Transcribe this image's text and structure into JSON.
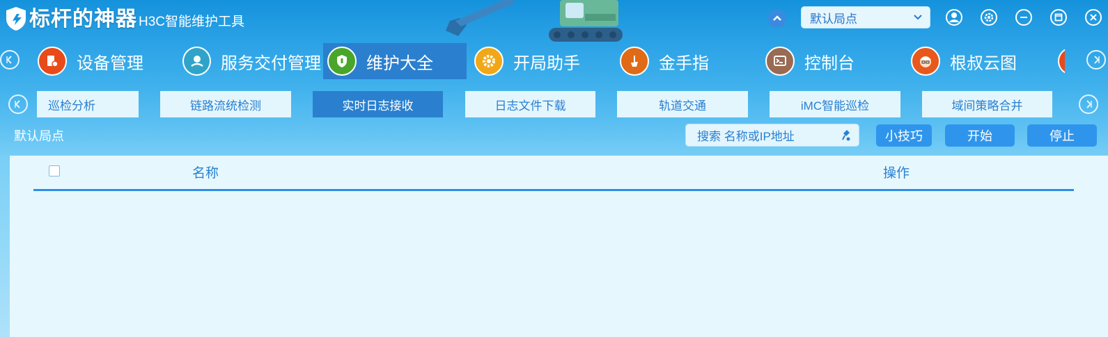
{
  "app": {
    "brand_main": "标杆的神器",
    "brand_sub": "H3C智能维护工具"
  },
  "titlebar": {
    "site_selector": "默认局点",
    "icons": [
      "collapse-up-icon",
      "user-icon",
      "gear-icon",
      "minimize-icon",
      "maximize-icon",
      "close-icon"
    ]
  },
  "main_nav": {
    "items": [
      {
        "label": "设备管理",
        "icon": "device-manage-icon",
        "color": "#e84a1a"
      },
      {
        "label": "服务交付管理",
        "icon": "service-delivery-icon",
        "color": "#2fa4c8"
      },
      {
        "label": "维护大全",
        "icon": "shield-icon",
        "color": "#4aa62a",
        "active": true
      },
      {
        "label": "开局助手",
        "icon": "gear-helper-icon",
        "color": "#f0a818"
      },
      {
        "label": "金手指",
        "icon": "golden-finger-icon",
        "color": "#e06a16"
      },
      {
        "label": "控制台",
        "icon": "console-icon",
        "color": "#9a6a52"
      },
      {
        "label": "根叔云图",
        "icon": "avatar-icon",
        "color": "#e8581c"
      }
    ]
  },
  "sub_nav": {
    "tabs": [
      {
        "label": "巡检分析"
      },
      {
        "label": "链路流统检测"
      },
      {
        "label": "实时日志接收",
        "active": true
      },
      {
        "label": "日志文件下载"
      },
      {
        "label": "轨道交通"
      },
      {
        "label": "iMC智能巡检"
      },
      {
        "label": "域间策略合并"
      }
    ]
  },
  "toolbar": {
    "site_label": "默认局点",
    "search_placeholder": "搜索 名称或IP地址",
    "tips_label": "小技巧",
    "start_label": "开始",
    "stop_label": "停止"
  },
  "table": {
    "columns": [
      "名称",
      "操作"
    ],
    "rows": []
  },
  "colors": {
    "title_blue": "#1592dc",
    "active_blue": "#2b7fcf",
    "button_blue": "#2f95ec",
    "panel_bg": "#e6f8fd",
    "accent_text": "#2a80d0"
  }
}
